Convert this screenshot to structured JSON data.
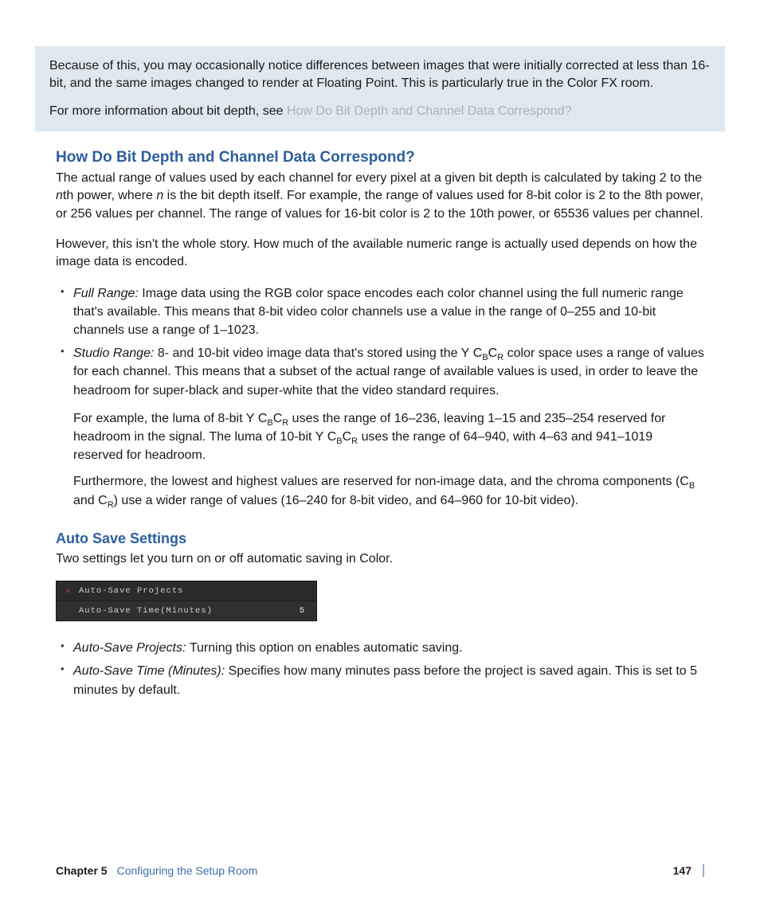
{
  "callout": {
    "p1": "Because of this, you may occasionally notice differences between images that were initially corrected at less than 16-bit, and the same images changed to render at Floating Point. This is particularly true in the Color FX room.",
    "p2_lead": "For more information about bit depth, see ",
    "p2_link": "How Do Bit Depth and Channel Data Correspond?"
  },
  "section1": {
    "heading": "How Do Bit Depth and Channel Data Correspond?",
    "p1_a": "The actual range of values used by each channel for every pixel at a given bit depth is calculated by taking 2 to the ",
    "p1_nth": "n",
    "p1_b": "th power, where ",
    "p1_n": "n",
    "p1_c": " is the bit depth itself. For example, the range of values used for 8-bit color is 2 to the 8th power, or 256 values per channel. The range of values for 16-bit color is 2 to the 10th power, or 65536 values per channel.",
    "p2": "However, this isn't the whole story. How much of the available numeric range is actually used depends on how the image data is encoded.",
    "bullets": {
      "full": {
        "term": "Full Range:  ",
        "text": "Image data using the RGB color space encodes each color channel using the full numeric range that's available. This means that 8-bit video color channels use a value in the range of 0–255 and 10-bit channels use a range of 1–1023."
      },
      "studio": {
        "term": "Studio Range:  ",
        "text_a": "8- and 10-bit video image data that's stored using the Y C",
        "text_b": "C",
        "text_c": " color space uses a range of values for each channel. This means that a subset of the actual range of available values is used, in order to leave the headroom for super-black and super-white that the video standard requires."
      }
    },
    "sub1_a": "For example, the luma of 8-bit Y C",
    "sub1_b": "C",
    "sub1_c": " uses the range of 16–236, leaving 1–15 and 235–254 reserved for headroom in the signal. The luma of 10-bit Y C",
    "sub1_d": "C",
    "sub1_e": " uses the range of 64–940, with 4–63 and 941–1019 reserved for headroom.",
    "sub2_a": "Furthermore, the lowest and highest values are reserved for non-image data, and the chroma components (C",
    "sub2_b": " and C",
    "sub2_c": ") use a wider range of values (16–240 for 8-bit video, and 64–960 for 10-bit video).",
    "subB": "B",
    "subR": "R"
  },
  "section2": {
    "heading": "Auto Save Settings",
    "intro": "Two settings let you turn on or off automatic saving in Color.",
    "ui": {
      "check_glyph": "✕",
      "row1": "Auto-Save Projects",
      "row2_label": "Auto-Save Time(Minutes)",
      "row2_value": "5"
    },
    "bullets": {
      "b1_term": "Auto-Save Projects:  ",
      "b1_text": "Turning this option on enables automatic saving.",
      "b2_term": "Auto-Save Time (Minutes):  ",
      "b2_text": "Specifies how many minutes pass before the project is saved again. This is set to 5 minutes by default."
    }
  },
  "footer": {
    "chapter_label": "Chapter 5",
    "chapter_title": "Configuring the Setup Room",
    "page": "147"
  }
}
